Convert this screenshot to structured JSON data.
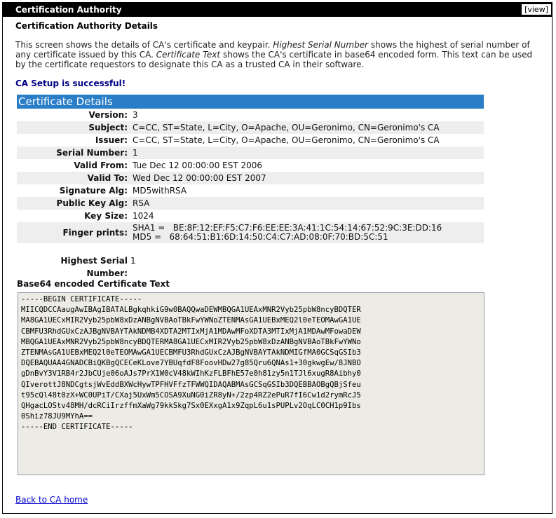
{
  "portlet": {
    "title": "Certification Authority",
    "view_label": "[view]"
  },
  "page": {
    "heading": "Certification Authority Details",
    "intro": {
      "part1": "This screen shows the details of CA's certificate and keypair. ",
      "highest_term": "Highest Serial Number",
      "part2": " shows the highest of serial number of any certificate issued by this CA. ",
      "cert_term": "Certificate Text",
      "part3": " shows the CA's certificate in base64 encoded form. This text can be used by the certificate requestors to designate this CA as a trusted CA in their software."
    },
    "status": "CA Setup is successful!",
    "details_title": "Certificate Details",
    "details": [
      {
        "label": "Version:",
        "value": "3"
      },
      {
        "label": "Subject:",
        "value": "C=CC, ST=State, L=City, O=Apache, OU=Geronimo, CN=Geronimo's CA"
      },
      {
        "label": "Issuer:",
        "value": "C=CC, ST=State, L=City, O=Apache, OU=Geronimo, CN=Geronimo's CA"
      },
      {
        "label": "Serial Number:",
        "value": "1"
      },
      {
        "label": "Valid From:",
        "value": "Tue Dec 12 00:00:00 EST 2006"
      },
      {
        "label": "Valid To:",
        "value": "Wed Dec 12 00:00:00 EST 2007"
      },
      {
        "label": "Signature Alg:",
        "value": "MD5withRSA"
      },
      {
        "label": "Public Key Alg:",
        "value": "RSA"
      },
      {
        "label": "Key Size:",
        "value": "1024"
      }
    ],
    "fingerprints": {
      "label": "Finger prints:",
      "sha1": "SHA1 =   BE:8F:12:EF:F5:C7:F6:EE:EE:3A:41:1C:54:14:67:52:9C:3E:DD:16",
      "md5": "MD5 =   68:64:51:B1:6D:14:50:C4:C7:AD:08:0F:70:BD:5C:51"
    },
    "highest_serial": {
      "label": "Highest Serial Number:",
      "value": "1"
    },
    "b64_title": "Base64 encoded Certificate Text",
    "certificate_text": "-----BEGIN CERTIFICATE-----\nMIICQDCCAaugAwIBAgIBATALBgkqhkiG9w0BAQQwaDEWMBQGA1UEAxMNR2Vyb25pbW8ncyBDQTER\nMA8GA1UECxMIR2Vyb25pbW8xDzANBgNVBAoTBkFwYWNoZTENMAsGA1UEBxMEQ2l0eTEOMAwGA1UE\nCBMFU3RhdGUxCzAJBgNVBAYTAkNDMB4XDTA2MTIxMjA1MDAwMFoXDTA3MTIxMjA1MDAwMFowaDEW\nMBQGA1UEAxMNR2Vyb25pbW8ncyBDQTERMA8GA1UECxMIR2Vyb25pbW8xDzANBgNVBAoTBkFwYWNo\nZTENMAsGA1UEBxMEQ2l0eTEOMAwGA1UECBMFU3RhdGUxCzAJBgNVBAYTAkNDMIGfMA0GCSqGSIb3\nDQEBAQUAA4GNADCBiQKBgQCECeKLove7YBUqfdF8FoovHDw27g85Qru6QNAs1+30gkwgEw/8JNBO\ngDnBvY3V1RB4r2JbCUje06oAJs7PrX1W0cV48kWIhKzFLBFhE57e0h81zy5n1TJl6xugR8Aibhy0\nQIverottJ8NDCgtsjWvEddBXWcHywTPFHVFfzTFWWQIDAQABMAsGCSqGSIb3DQEBBAOBgQBjSfeu\nt95cQl48t0zX+WC0UPiT/CXaj5UxWm5COSA9XuNG0iZR8yN+/2zp4RZ2ePuR7fI6Cw1d2rymRcJ5\nQHgacLOStv48MH/dcRCiIrzffmXaWg79kkSkg7Sx0EXxgA1x9ZqpL6u1sPUPLv2OqLC0CH1p9Ibs\n0Shiz78JU9MYhA==\n-----END CERTIFICATE-----",
    "back_link": "Back to CA home"
  }
}
